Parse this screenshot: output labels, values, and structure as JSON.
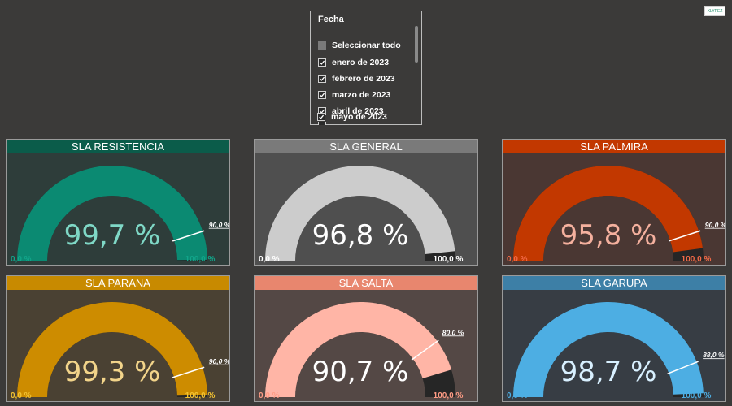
{
  "slicer": {
    "title": "Fecha",
    "select_all": "Seleccionar todo",
    "items": [
      "enero de 2023",
      "febrero de 2023",
      "marzo de 2023",
      "abril de 2023",
      "mayo de 2023"
    ]
  },
  "corner_button": "XLYPEZ",
  "cards": [
    {
      "title": "SLA RESISTENCIA",
      "value": 99.7,
      "value_label": "99,7 %",
      "min_label": "0,0 %",
      "max_label": "100,0 %",
      "target": 90.0,
      "target_label": "90,0 %",
      "header_color": "#0b5c4a",
      "card_bg": "#2e3d3a",
      "arc_color": "#0b8a72",
      "track_color": "#262626",
      "value_text_color": "#7fd8c6",
      "minmax_color": "#11a58a"
    },
    {
      "title": "SLA GENERAL",
      "value": 96.8,
      "value_label": "96,8 %",
      "min_label": "0,0 %",
      "max_label": "100,0 %",
      "target": null,
      "target_label": "",
      "header_color": "#7a7a7a",
      "card_bg": "#4f4f4f",
      "arc_color": "#cccccc",
      "track_color": "#262626",
      "value_text_color": "#ffffff",
      "minmax_color": "#ffffff"
    },
    {
      "title": "SLA PALMIRA",
      "value": 95.8,
      "value_label": "95,8 %",
      "min_label": "0,0 %",
      "max_label": "100,0 %",
      "target": 90.0,
      "target_label": "90,0 %",
      "header_color": "#c23800",
      "card_bg": "#4a3733",
      "arc_color": "#c23800",
      "track_color": "#262626",
      "value_text_color": "#f4b09e",
      "minmax_color": "#f26a47"
    },
    {
      "title": "SLA PARANA",
      "value": 99.3,
      "value_label": "99,3 %",
      "min_label": "0,0 %",
      "max_label": "100,0 %",
      "target": 90.0,
      "target_label": "90,0 %",
      "header_color": "#c88a00",
      "card_bg": "#4a4133",
      "arc_color": "#cd8c00",
      "track_color": "#262626",
      "value_text_color": "#f2d48a",
      "minmax_color": "#f2c232"
    },
    {
      "title": "SLA SALTA",
      "value": 90.7,
      "value_label": "90,7 %",
      "min_label": "0,0 %",
      "max_label": "100,0 %",
      "target": 80.0,
      "target_label": "80,0 %",
      "header_color": "#e8866e",
      "card_bg": "#544845",
      "arc_color": "#ffb5a6",
      "track_color": "#262626",
      "value_text_color": "#ffffff",
      "minmax_color": "#ff9c85"
    },
    {
      "title": "SLA GARUPA",
      "value": 98.7,
      "value_label": "98,7 %",
      "min_label": "0,0 %",
      "max_label": "100,0 %",
      "target": 88.0,
      "target_label": "88,0 %",
      "header_color": "#3d7fa6",
      "card_bg": "#373d44",
      "arc_color": "#4daee3",
      "track_color": "#262626",
      "value_text_color": "#d8f0ff",
      "minmax_color": "#4daee3"
    }
  ]
}
